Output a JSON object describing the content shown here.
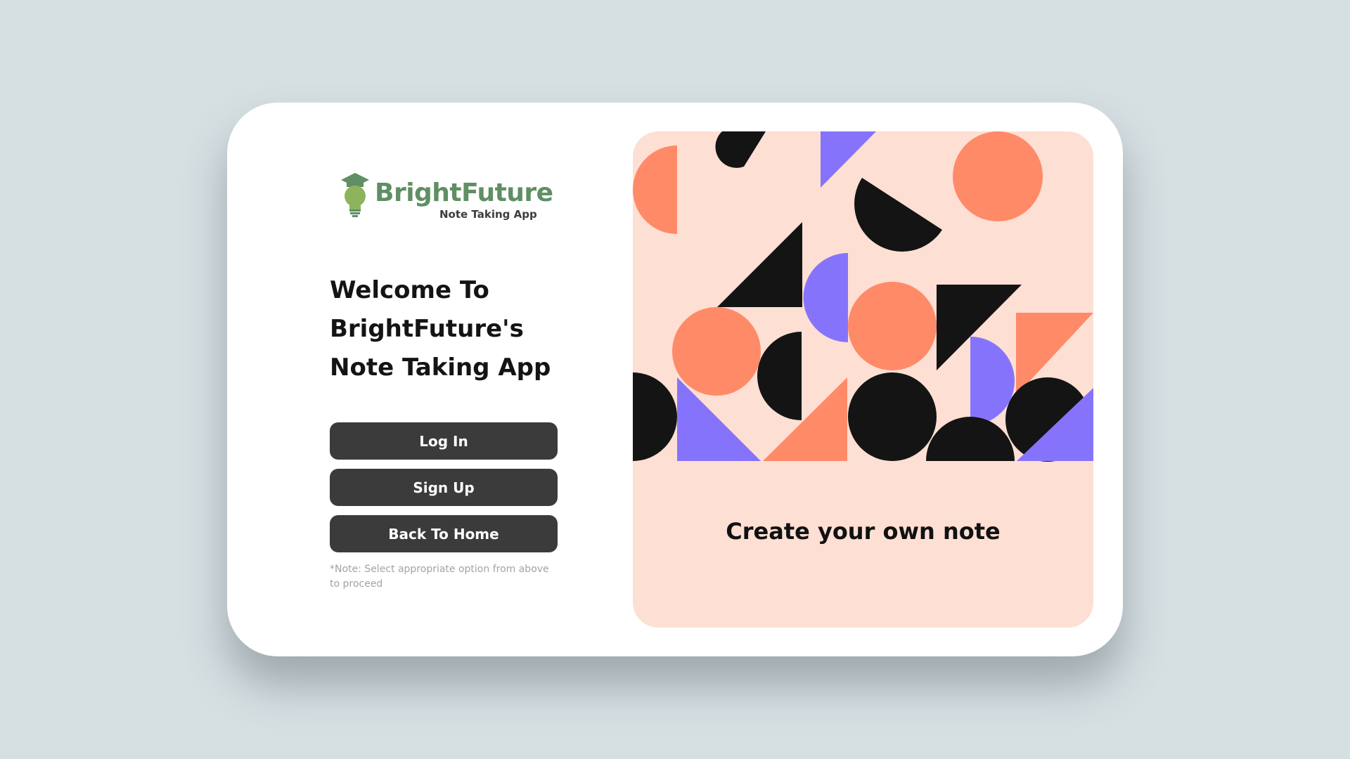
{
  "logo": {
    "name": "BrightFuture",
    "subtitle": "Note Taking App",
    "icon": "graduation-lightbulb-icon",
    "color": "#5f8f63"
  },
  "welcome": {
    "line1": "Welcome To",
    "line2": "BrightFuture's",
    "line3": "Note Taking App"
  },
  "buttons": {
    "login": "Log In",
    "signup": "Sign Up",
    "home": "Back To Home"
  },
  "note": "*Note: Select appropriate option from above to proceed",
  "panel": {
    "tagline": "Create your own note",
    "background": "#fedfd3"
  },
  "colors": {
    "page_background": "#d6dfe2",
    "card": "#ffffff",
    "button": "#3b3b3b",
    "coral": "#ff8a68",
    "purple": "#8574fb",
    "black": "#141414"
  }
}
